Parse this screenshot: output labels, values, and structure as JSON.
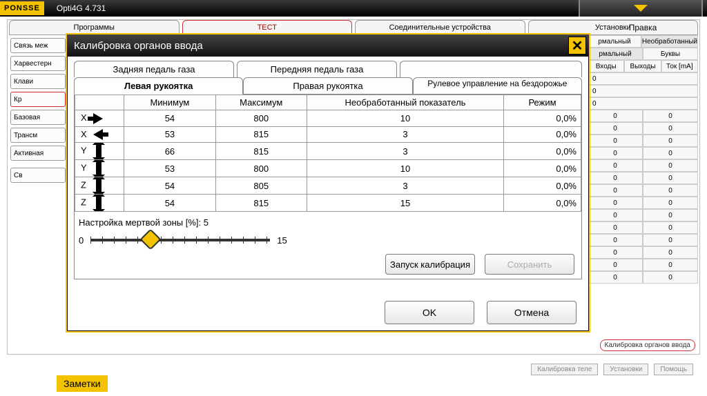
{
  "topbar": {
    "logo": "PONSSE",
    "title": "Opti4G 4.731"
  },
  "background": {
    "top_tabs": [
      "Программы",
      "ТЕСТ",
      "Соединительные устройства",
      "Установки"
    ],
    "left_buttons": [
      "Связь меж",
      "Харвестерн",
      "Клави",
      "Кр",
      "Базовая",
      "Трансм",
      "Активная",
      "Св"
    ],
    "right": {
      "header": "Правка",
      "row1": [
        "рмальный",
        "Необработанный"
      ],
      "row2": [
        "рмальный",
        "Буквы"
      ],
      "row3": [
        "Входы",
        "Выходы",
        "Ток [mA]"
      ],
      "val_single": "0",
      "val_pair": [
        "0",
        "0"
      ],
      "footer": "Калибровка органов ввода"
    }
  },
  "modal": {
    "title": "Калибровка органов ввода",
    "tabs1": [
      "Задняя педаль газа",
      "Передняя педаль газа",
      ""
    ],
    "tabs2": [
      "Левая рукоятка",
      "Правая рукоятка",
      "Рулевое управление на бездорожье"
    ],
    "active_tab2": 0,
    "columns": [
      "",
      "Минимум",
      "Максимум",
      "Необработанный показатель",
      "Режим"
    ],
    "rows": [
      {
        "axis": "X",
        "dir": "right",
        "min": "54",
        "max": "800",
        "raw": "10",
        "mode": "0,0%"
      },
      {
        "axis": "X",
        "dir": "left",
        "min": "53",
        "max": "815",
        "raw": "3",
        "mode": "0,0%"
      },
      {
        "axis": "Y",
        "dir": "updown",
        "min": "66",
        "max": "815",
        "raw": "3",
        "mode": "0,0%"
      },
      {
        "axis": "Y",
        "dir": "updown",
        "min": "53",
        "max": "800",
        "raw": "10",
        "mode": "0,0%"
      },
      {
        "axis": "Z",
        "dir": "updown",
        "min": "54",
        "max": "805",
        "raw": "3",
        "mode": "0,0%"
      },
      {
        "axis": "Z",
        "dir": "updown",
        "min": "54",
        "max": "815",
        "raw": "15",
        "mode": "0,0%"
      }
    ],
    "deadzone": {
      "label": "Настройка мертвой зоны [%]:",
      "value": "5",
      "min": "0",
      "max": "15"
    },
    "cal_buttons": {
      "start": "Запуск калибрация",
      "save": "Сохранить"
    },
    "ok": "OK",
    "cancel": "Отмена"
  },
  "footer": {
    "note": "Заметки",
    "bottom": [
      "Калибровка теле",
      "Установки",
      "Помощь"
    ]
  }
}
